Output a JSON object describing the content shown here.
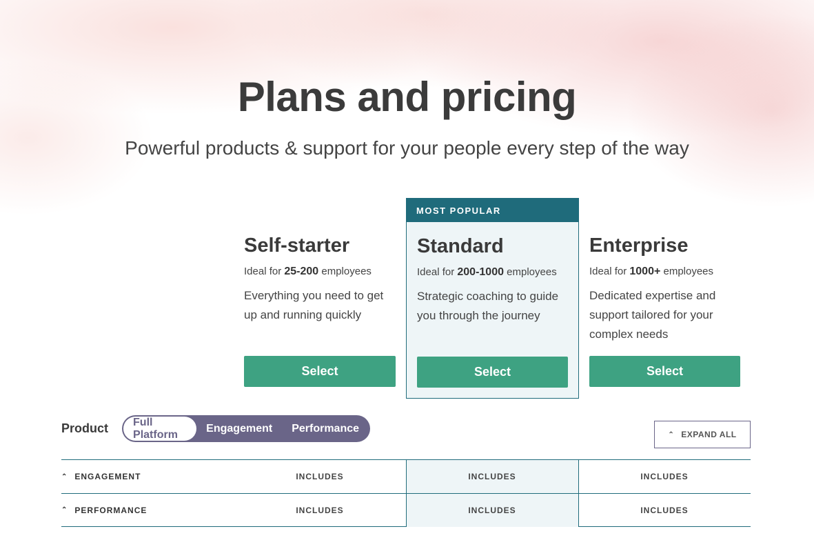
{
  "hero": {
    "title": "Plans and pricing",
    "subtitle": "Powerful products & support for your people every step of the way"
  },
  "plans": [
    {
      "name": "Self-starter",
      "ideal_prefix": "Ideal for",
      "ideal_range": "25-200",
      "ideal_suffix": "employees",
      "description": "Everything you need to get up and running quickly",
      "button": "Select"
    },
    {
      "badge": "MOST POPULAR",
      "name": "Standard",
      "ideal_prefix": "Ideal for",
      "ideal_range": "200-1000",
      "ideal_suffix": "employees",
      "description": "Strategic coaching to guide you through the journey",
      "button": "Select"
    },
    {
      "name": "Enterprise",
      "ideal_prefix": "Ideal for",
      "ideal_range": "1000+",
      "ideal_suffix": "employees",
      "description": "Dedicated expertise and support tailored for your complex needs",
      "button": "Select"
    }
  ],
  "product_filter": {
    "label": "Product",
    "options": [
      "Full Platform",
      "Engagement",
      "Performance"
    ],
    "selected": "Full Platform"
  },
  "expand_all": "EXPAND ALL",
  "rows": [
    {
      "label": "ENGAGEMENT",
      "values": [
        "INCLUDES",
        "INCLUDES",
        "INCLUDES"
      ]
    },
    {
      "label": "PERFORMANCE",
      "values": [
        "INCLUDES",
        "INCLUDES",
        "INCLUDES"
      ]
    }
  ],
  "colors": {
    "button_green": "#3ea282",
    "teal_accent": "#1f6b7b",
    "segment_purple": "#6a6588",
    "featured_bg": "#eef5f7"
  }
}
